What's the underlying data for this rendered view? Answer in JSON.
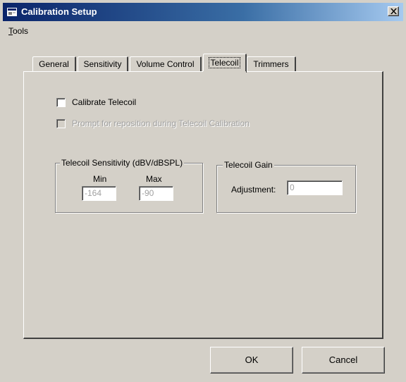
{
  "window": {
    "title": "Calibration Setup",
    "close_symbol": "X",
    "title_gradient_start": "#0a246a",
    "title_gradient_end": "#a6caf0",
    "face_color": "#d4d0c8"
  },
  "menu": {
    "tools_label_first": "T",
    "tools_label_rest": "ools"
  },
  "tabs": [
    {
      "label": "General",
      "active": false
    },
    {
      "label": "Sensitivity",
      "active": false
    },
    {
      "label": "Volume Control",
      "active": false
    },
    {
      "label": "Telecoil",
      "active": true
    },
    {
      "label": "Trimmers",
      "active": false
    }
  ],
  "telecoil": {
    "calibrate_checkbox": {
      "label": "Calibrate Telecoil",
      "checked": false,
      "enabled": true
    },
    "prompt_checkbox": {
      "label": "Prompt for reposition during Telecoil Calibration",
      "checked": false,
      "enabled": false
    },
    "sensitivity_group": {
      "title": "Telecoil Sensitivity (dBV/dBSPL)",
      "min_label": "Min",
      "max_label": "Max",
      "min_value": "-164",
      "max_value": "-90"
    },
    "gain_group": {
      "title": "Telecoil Gain",
      "adjustment_label": "Adjustment:",
      "adjustment_value": "0"
    }
  },
  "buttons": {
    "ok": "OK",
    "cancel": "Cancel"
  },
  "icons": {
    "window_icon": "app-window-icon",
    "close_icon": "close-x-icon"
  }
}
